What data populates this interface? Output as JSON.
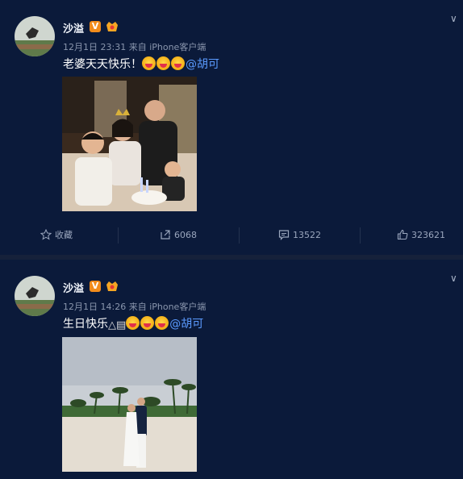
{
  "posts": [
    {
      "username": "沙溢",
      "verified_badge": "V",
      "timestamp": "12月1日 23:31",
      "source": "来自 iPhone客户端",
      "text": "老婆天天快乐！",
      "mention": "@胡可",
      "emoji_count": 3,
      "actions": {
        "favorite": "收藏",
        "repost": "6068",
        "comment": "13522",
        "like": "323621"
      }
    },
    {
      "username": "沙溢",
      "verified_badge": "V",
      "timestamp": "12月1日 14:26",
      "source": "来自 iPhone客户端",
      "text": "生日快乐",
      "mention": "@胡可",
      "emoji_count": 3
    }
  ],
  "icons": [
    "avatar",
    "verified-icon",
    "vip-icon",
    "chevron-down-icon",
    "star-icon",
    "repost-icon",
    "comment-icon",
    "like-icon"
  ],
  "colors": {
    "background": "#0b1a3a",
    "mention": "#5b9bff",
    "badge": "#f28c1b"
  }
}
